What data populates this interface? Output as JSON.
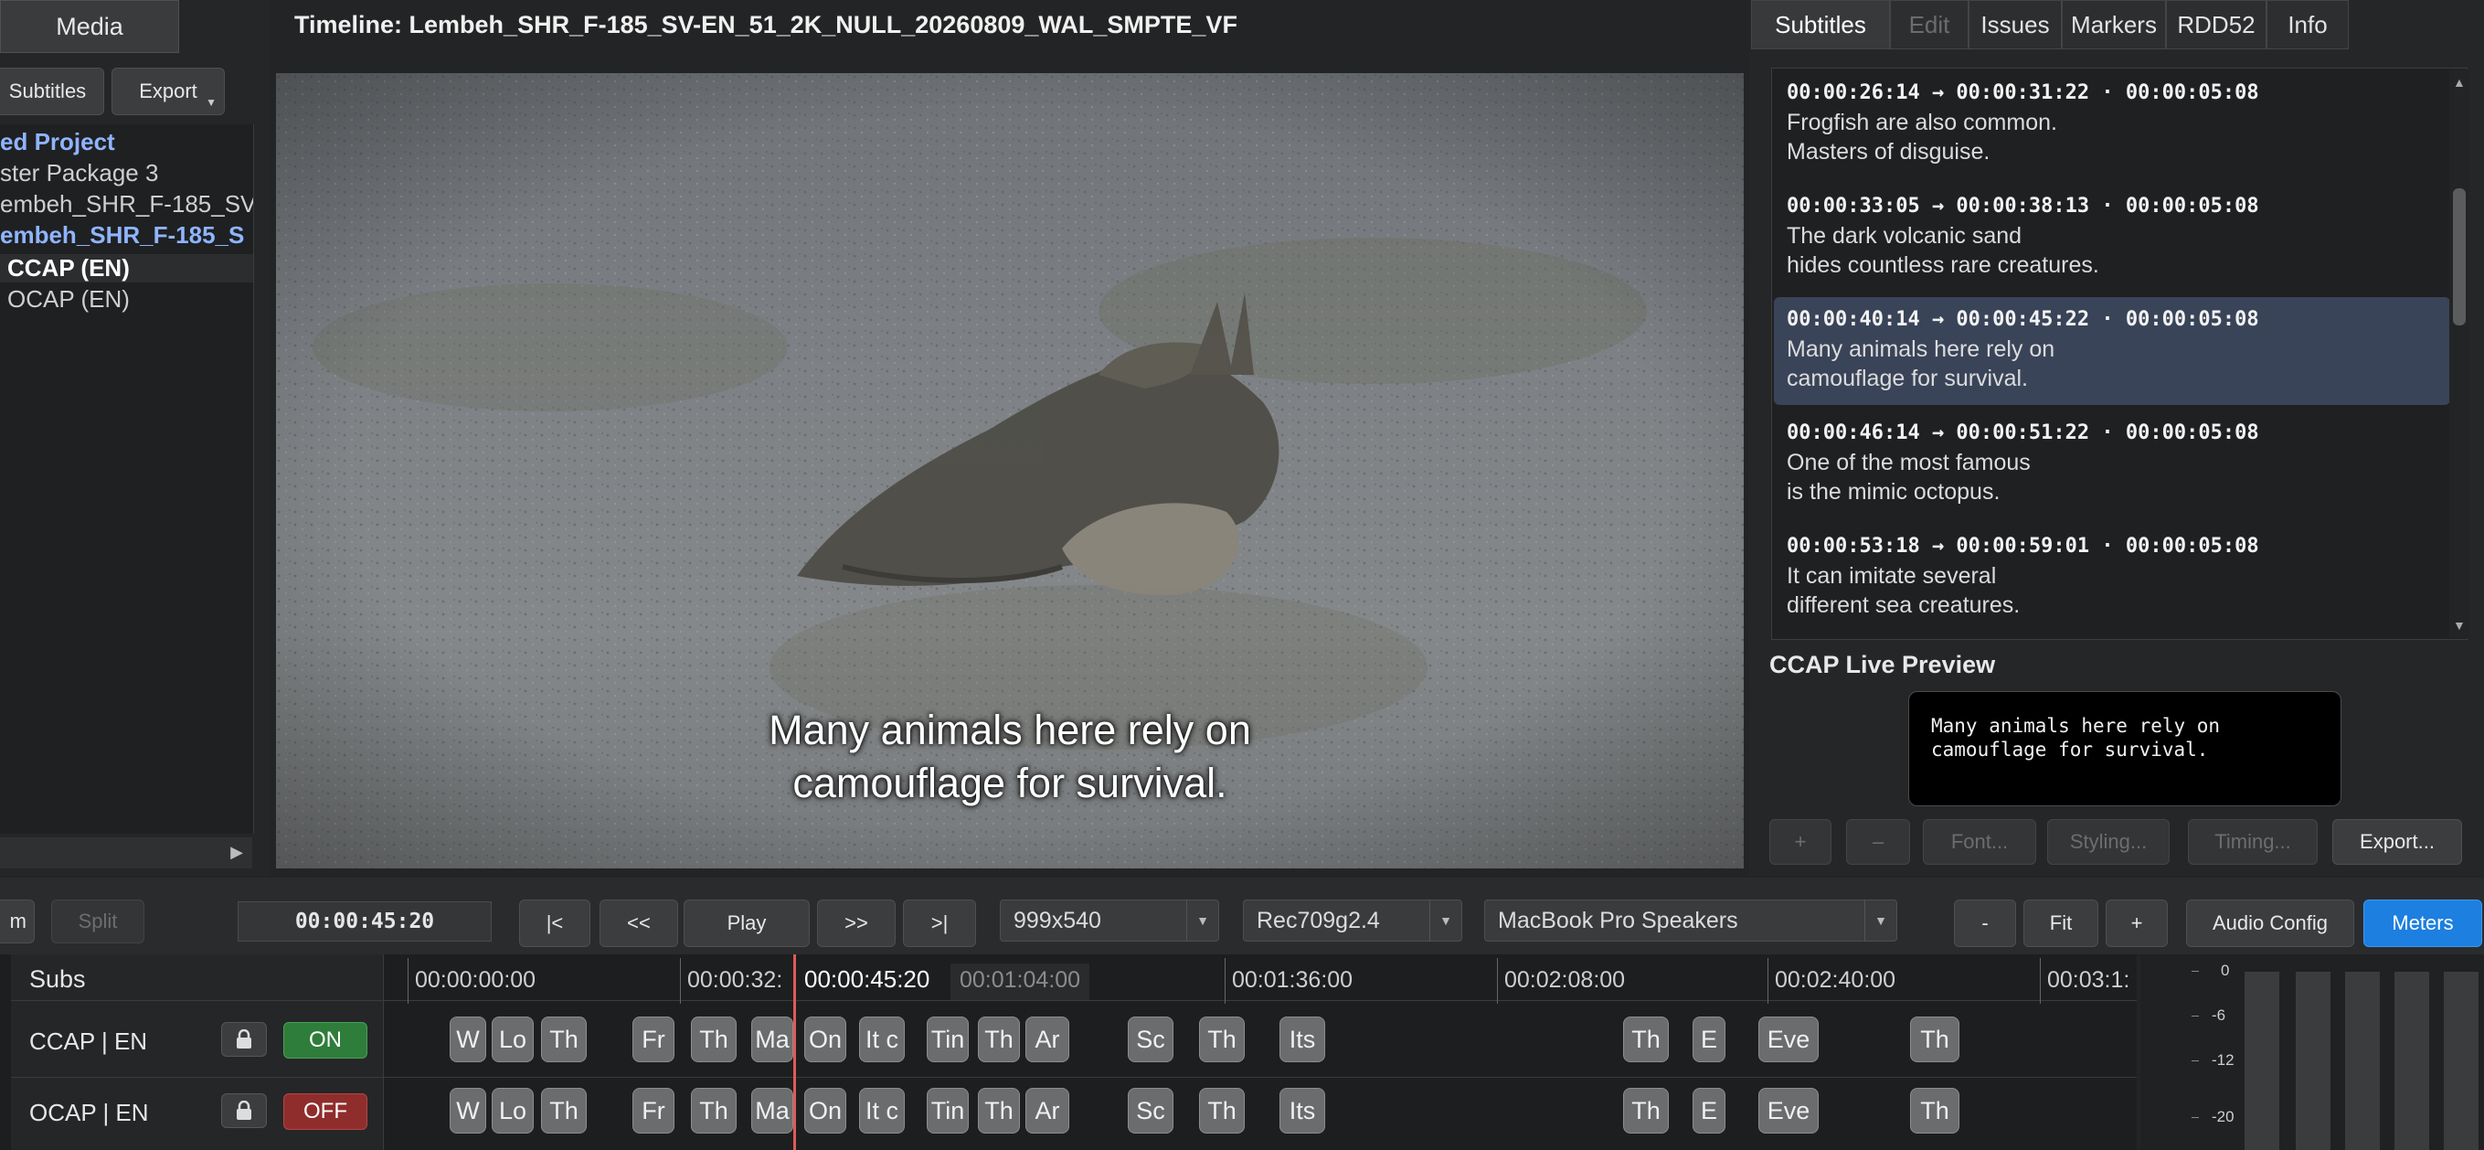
{
  "media_tab": {
    "label": "Media"
  },
  "left_panel": {
    "subtitles_button": "Subtitles",
    "export_button": "Export",
    "tree": [
      {
        "label": "ed Project",
        "style": "project"
      },
      {
        "label": "ster Package 3",
        "style": "normal"
      },
      {
        "label": "embeh_SHR_F-185_SV",
        "style": "normal"
      },
      {
        "label": "embeh_SHR_F-185_S",
        "style": "highlight"
      },
      {
        "label": "CCAP (EN)",
        "style": "selected"
      },
      {
        "label": "OCAP (EN)",
        "style": "normal"
      }
    ]
  },
  "viewer": {
    "title": "Timeline: Lembeh_SHR_F-185_SV-EN_51_2K_NULL_20260809_WAL_SMPTE_VF",
    "caption_line1": "Many animals here rely on",
    "caption_line2": "camouflage for survival."
  },
  "right_tabs": [
    {
      "label": "Subtitles",
      "state": "active"
    },
    {
      "label": "Edit",
      "state": "disabled"
    },
    {
      "label": "Issues",
      "state": "normal"
    },
    {
      "label": "Markers",
      "state": "normal"
    },
    {
      "label": "RDD52",
      "state": "normal"
    },
    {
      "label": "Info",
      "state": "normal"
    }
  ],
  "subtitle_list": [
    {
      "time": "00:00:26:14 → 00:00:31:22 · 00:00:05:08",
      "line1": "Frogfish are also common.",
      "line2": "Masters of disguise.",
      "selected": false
    },
    {
      "time": "00:00:33:05 → 00:00:38:13 · 00:00:05:08",
      "line1": "The dark volcanic sand",
      "line2": "hides countless rare creatures.",
      "selected": false
    },
    {
      "time": "00:00:40:14 → 00:00:45:22 · 00:00:05:08",
      "line1": "Many animals here rely on",
      "line2": "camouflage for survival.",
      "selected": true
    },
    {
      "time": "00:00:46:14 → 00:00:51:22 · 00:00:05:08",
      "line1": "One of the most famous",
      "line2": "is the mimic octopus.",
      "selected": false
    },
    {
      "time": "00:00:53:18 → 00:00:59:01 · 00:00:05:08",
      "line1": "It can imitate several",
      "line2": "different sea creatures.",
      "selected": false
    }
  ],
  "live_preview": {
    "heading": "CCAP Live Preview",
    "line1": "Many animals here rely on",
    "line2": "camouflage for survival."
  },
  "subtitle_actions": {
    "add": "+",
    "remove": "–",
    "font": "Font...",
    "styling": "Styling...",
    "timing": "Timing...",
    "export": "Export..."
  },
  "transport": {
    "trim_label": "m",
    "split_label": "Split",
    "timecode": "00:00:45:20",
    "go_start": "|<",
    "rewind": "<<",
    "play": "Play",
    "forward": ">>",
    "go_end": ">|",
    "resolution": "999x540",
    "colorspace": "Rec709g2.4",
    "audio_device": "MacBook Pro Speakers",
    "zoom_out": "-",
    "fit": "Fit",
    "zoom_in": "+",
    "audio_config": "Audio Config",
    "meters": "Meters"
  },
  "timeline": {
    "subs_header": "Subs",
    "ruler_labels": [
      "00:00:00:00",
      "00:00:32:",
      "00:01:36:00",
      "00:02:08:00",
      "00:02:40:00",
      "00:03:1:"
    ],
    "playhead_label": "00:00:45:20",
    "hover_label": "00:01:04:00",
    "tracks": [
      {
        "name": "CCAP | EN",
        "toggle": "ON",
        "lock_icon": "lock-icon"
      },
      {
        "name": "OCAP | EN",
        "toggle": "OFF",
        "lock_icon": "lock-icon"
      }
    ],
    "clip_labels": [
      "W",
      "Lo",
      "Th",
      "Fr",
      "Th",
      "Ma",
      "On",
      "It c",
      "Tin",
      "Th",
      "Ar",
      "Sc",
      "Th",
      "Its",
      "Th",
      "E",
      "Eve",
      "Th"
    ]
  },
  "meter_scale": [
    "0",
    "-6",
    "-12",
    "-20"
  ],
  "colors": {
    "accent_blue": "#1d7fe0",
    "selection": "#3a4459",
    "on_green": "#2f7d3a",
    "off_red": "#8f2d2d",
    "playhead": "#e05a5a"
  }
}
